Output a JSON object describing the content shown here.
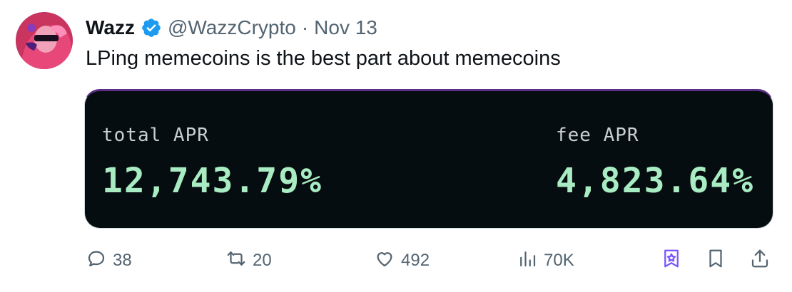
{
  "tweet": {
    "author": {
      "display_name": "Wazz",
      "handle": "@WazzCrypto",
      "separator": "·",
      "date": "Nov 13",
      "verified": true,
      "avatar_icon": "avatar-image"
    },
    "text": "LPing memecoins is the best part about memecoins"
  },
  "card": {
    "background": "#060d10",
    "accent": "#a9ecc3",
    "left_metric": {
      "label": "total APR",
      "value": "12,743.79%"
    },
    "right_metric": {
      "label": "fee APR",
      "value": "4,823.64%"
    }
  },
  "actions": {
    "replies": "38",
    "retweets": "20",
    "likes": "492",
    "views": "70K",
    "icons": [
      "reply-icon",
      "retweet-icon",
      "like-icon",
      "views-icon",
      "grok-icon",
      "bookmark-icon",
      "share-icon"
    ]
  },
  "colors": {
    "verified": "#1d9bf0",
    "muted": "#536471",
    "grok": "#7856ff"
  }
}
